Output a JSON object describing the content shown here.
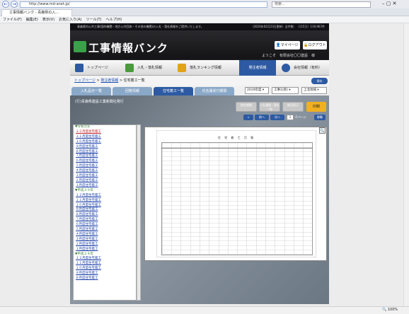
{
  "browser": {
    "url": "http://www.md-anet.jp/",
    "search_placeholder": "検索...",
    "tab_title": "工事情報バンク - 青森県の入...",
    "menu": [
      "ファイル(F)",
      "編集(E)",
      "表示(V)",
      "お気に入り(A)",
      "ツール(T)",
      "ヘルプ(H)"
    ],
    "zoom": "100%"
  },
  "site": {
    "tagline": "青森県内公共工事(国的機関・地方公共団体・その他の機関)の入札・落札情報をご提供いたします。",
    "update_info": "（2020年02月23日更新）全件数：（115万）119,967件",
    "logo_text": "工事情報バンク",
    "mypage_label": "マイページ",
    "logout_label": "ログアウト",
    "welcome": "ようこそ　有限会社〇〇建設　様",
    "nav": [
      {
        "label": "トップページ"
      },
      {
        "label": "入札・落札情報"
      },
      {
        "label": "落札ランキング情報"
      },
      {
        "label": "発注者情報"
      },
      {
        "label": "会社情報（有料）"
      }
    ],
    "breadcrumb": {
      "home": "トップページ",
      "section": "発注者情報",
      "current": "住宅着工一覧"
    },
    "print_label": "保存",
    "page_tabs": [
      "入札品示一覧",
      "回覧情報",
      "住宅着工一覧",
      "氏名履受付期間"
    ],
    "selects": {
      "year": "2019年度",
      "category": "工事1(新)",
      "region": "上北地域"
    },
    "org_name": "(行)青森県建設工業新聞社発行",
    "grey_buttons": [
      "指名期間",
      "入札通過・落札一覧",
      "前回表示"
    ],
    "yellow_button": "印刷",
    "pager": {
      "prev": "前へ",
      "next": "次へ",
      "page": "1",
      "total": "/1ページ",
      "go": "移動"
    },
    "doc_title": "住 宅 着 工 月 報",
    "list_groups": [
      {
        "year": "▼令和元年",
        "items": [
          "１２月度住宅着工",
          "１１月度住宅着工",
          "１０月度住宅着工",
          "９月度住宅着工",
          "８月度住宅着工",
          "７月度住宅着工",
          "６月度住宅着工",
          "５月度住宅着工",
          "４月度住宅着工",
          "３月度住宅着工",
          "２月度住宅着工",
          "１月度住宅着工"
        ]
      },
      {
        "year": "▼平成３０年",
        "items": [
          "１２月度住宅着工",
          "１１月度住宅着工",
          "１０月度住宅着工",
          "９月度住宅着工",
          "８月度住宅着工",
          "７月度住宅着工",
          "６月度住宅着工",
          "５月度住宅着工",
          "４月度住宅着工",
          "３月度住宅着工",
          "２月度住宅着工",
          "１月度住宅着工"
        ]
      },
      {
        "year": "▼平成２９年",
        "items": [
          "１２月度住宅着工",
          "１１月度住宅着工",
          "１０月度住宅着工",
          "９月度住宅着工",
          "８月度住宅着工"
        ]
      }
    ]
  }
}
